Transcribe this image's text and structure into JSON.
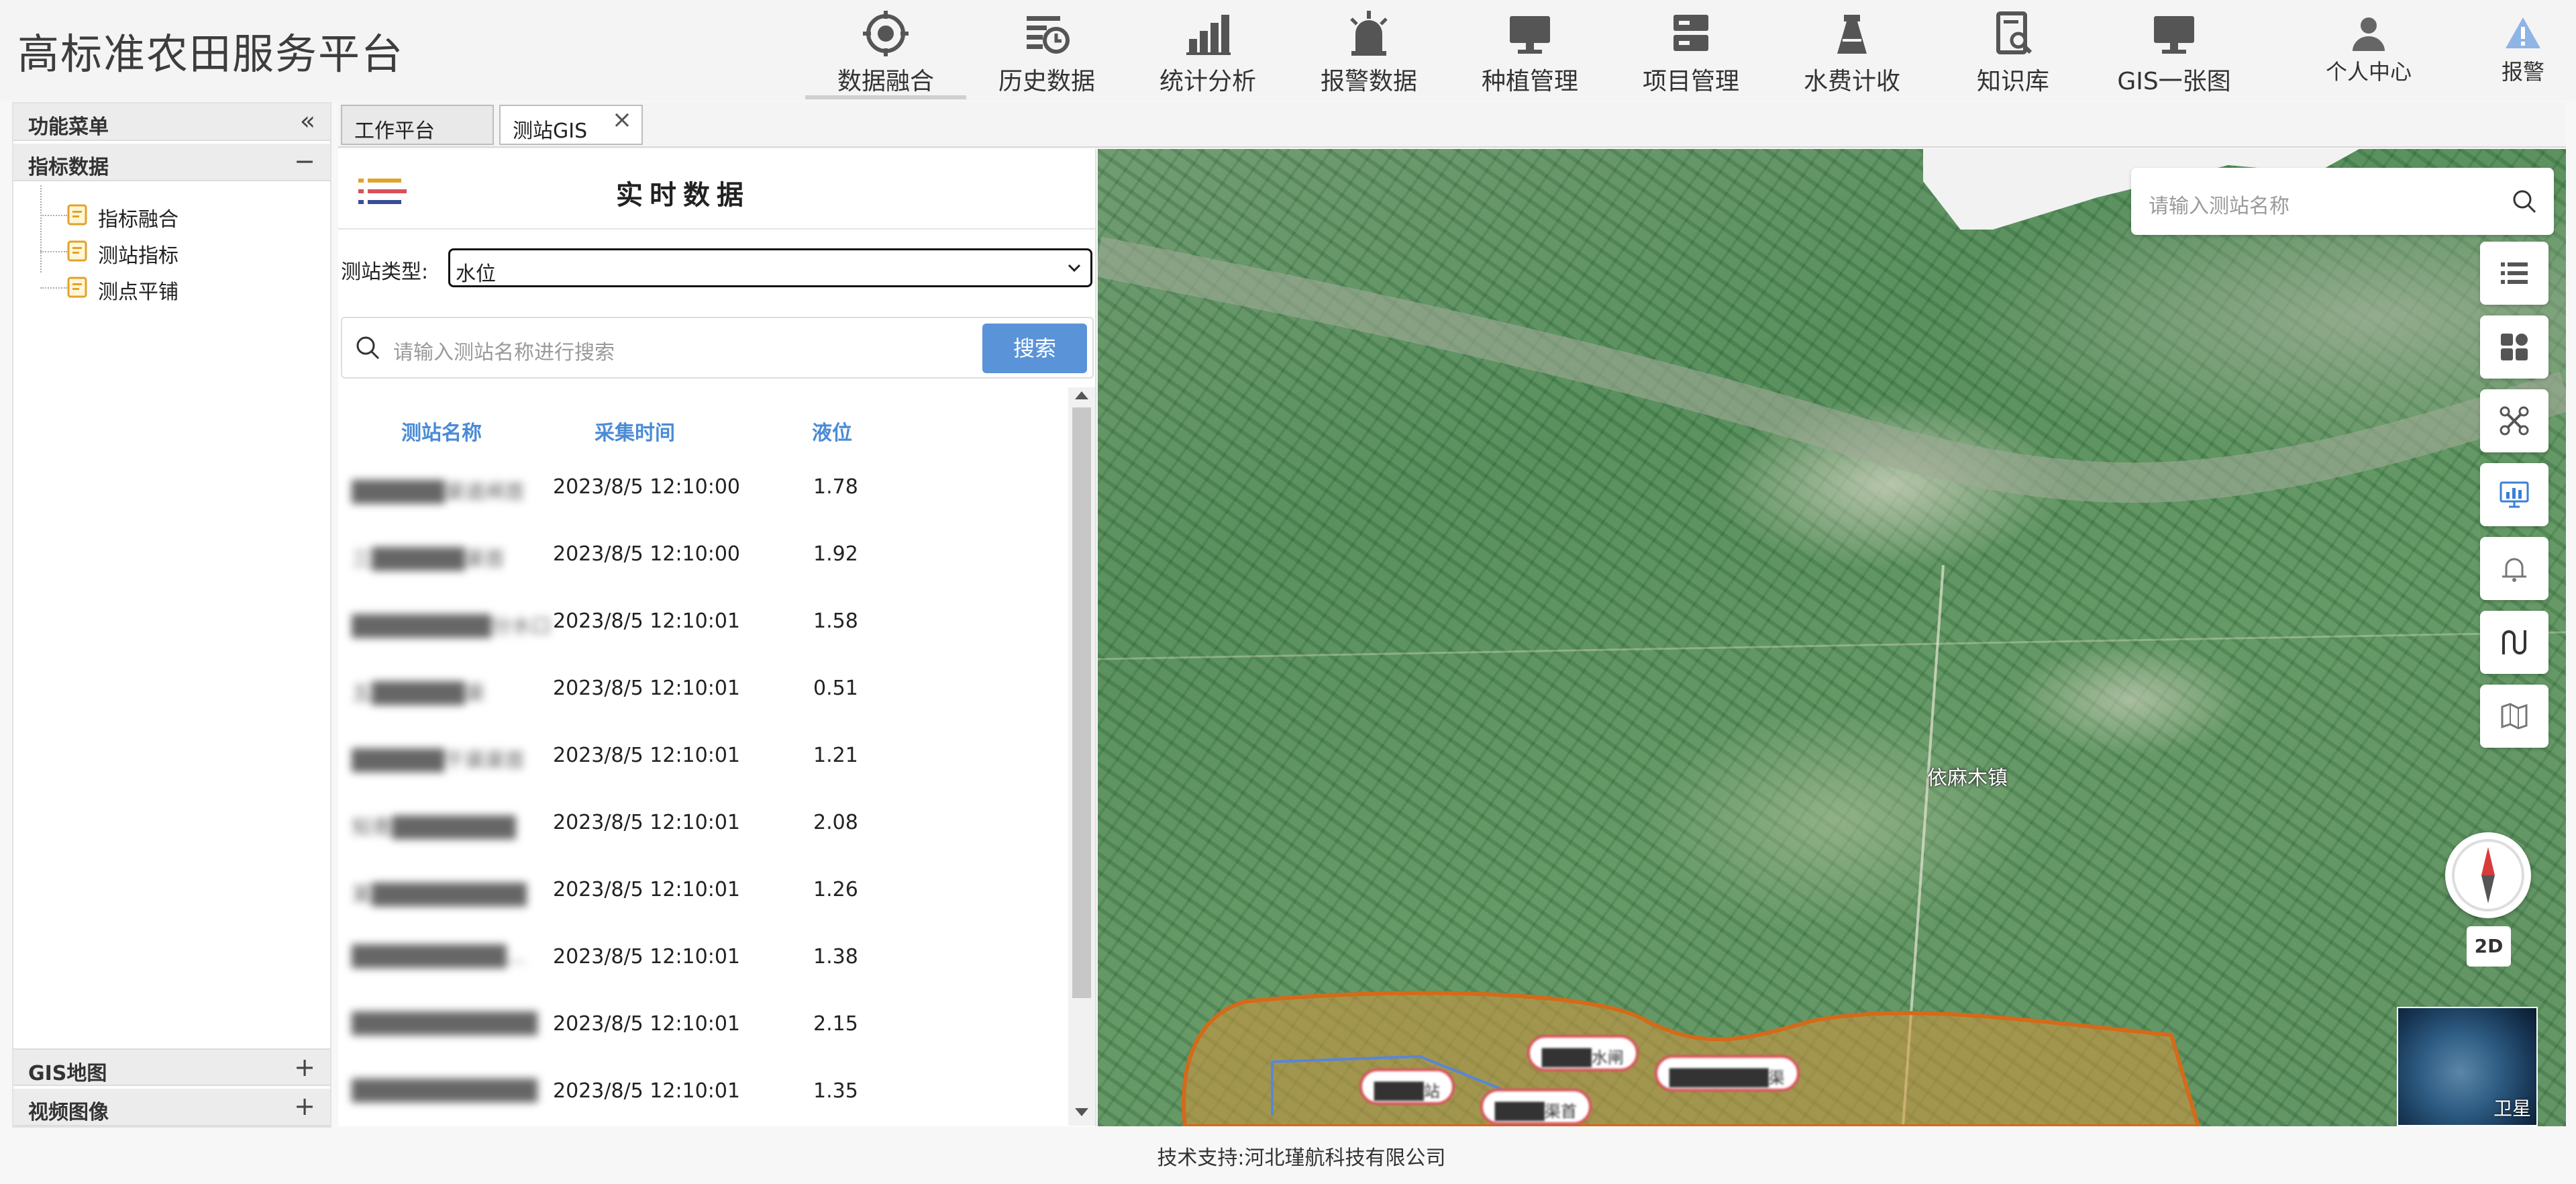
{
  "app": {
    "title": "高标准农田服务平台"
  },
  "nav": {
    "items": [
      {
        "label": "数据融合",
        "icon": "target-icon"
      },
      {
        "label": "历史数据",
        "icon": "history-list-icon"
      },
      {
        "label": "统计分析",
        "icon": "bar-chart-icon"
      },
      {
        "label": "报警数据",
        "icon": "siren-icon"
      },
      {
        "label": "种植管理",
        "icon": "monitor-icon"
      },
      {
        "label": "项目管理",
        "icon": "server-icon"
      },
      {
        "label": "水费计收",
        "icon": "tower-icon"
      },
      {
        "label": "知识库",
        "icon": "book-search-icon"
      },
      {
        "label": "GIS一张图",
        "icon": "monitor-icon"
      }
    ],
    "user_center": "个人中心",
    "alarm": "报警"
  },
  "sidebar": {
    "header_title": "功能菜单",
    "collapse_symbol": "«",
    "sections": [
      {
        "title": "指标数据",
        "toggle": "−",
        "items": [
          "指标融合",
          "测站指标",
          "测点平铺"
        ]
      },
      {
        "title": "GIS地图",
        "toggle": "+"
      },
      {
        "title": "视频图像",
        "toggle": "+"
      }
    ]
  },
  "tabs": [
    {
      "label": "工作平台"
    },
    {
      "label": "测站GIS",
      "close": "×"
    }
  ],
  "panel": {
    "title": "实时数据",
    "type_label": "测站类型:",
    "type_value": "水位",
    "search_placeholder": "请输入测站名称进行搜索",
    "search_button": "搜索",
    "columns": [
      "测站名称",
      "采集时间",
      "液位"
    ],
    "rows": [
      {
        "name": "██████渠道闸首",
        "time": "2023/8/5 12:10:00",
        "level": "1.78"
      },
      {
        "name": "三██████渠首",
        "time": "2023/8/5 12:10:00",
        "level": "1.92"
      },
      {
        "name": "█████████分水口",
        "time": "2023/8/5 12:10:01",
        "level": "1.58"
      },
      {
        "name": "五██████渠",
        "time": "2023/8/5 12:10:01",
        "level": "0.51"
      },
      {
        "name": "██████干渠渠首",
        "time": "2023/8/5 12:10:01",
        "level": "1.21"
      },
      {
        "name": "知青████████",
        "time": "2023/8/5 12:10:01",
        "level": "2.08"
      },
      {
        "name": "某██████████",
        "time": "2023/8/5 12:10:01",
        "level": "1.26"
      },
      {
        "name": "██████████...",
        "time": "2023/8/5 12:10:01",
        "level": "1.38"
      },
      {
        "name": "████████████",
        "time": "2023/8/5 12:10:01",
        "level": "2.15"
      },
      {
        "name": "████████████",
        "time": "2023/8/5 12:10:01",
        "level": "1.35"
      }
    ]
  },
  "map": {
    "search_placeholder": "请输入测站名称",
    "town_label": "依麻木镇",
    "btn_2d": "2D",
    "satellite_label": "卫星",
    "tools": [
      "layers-list-icon",
      "widgets-icon",
      "drone-icon",
      "dashboard-icon",
      "bell-icon",
      "route-icon",
      "map-icon"
    ],
    "pins": [
      "████水闸",
      "████████渠",
      "████站",
      "████渠首"
    ]
  },
  "footer": {
    "text": "技术支持:河北瑾航科技有限公司"
  },
  "colors": {
    "accent_blue": "#5b93d8",
    "header_blue": "#4a8bd6",
    "nav_icon": "#555555"
  }
}
